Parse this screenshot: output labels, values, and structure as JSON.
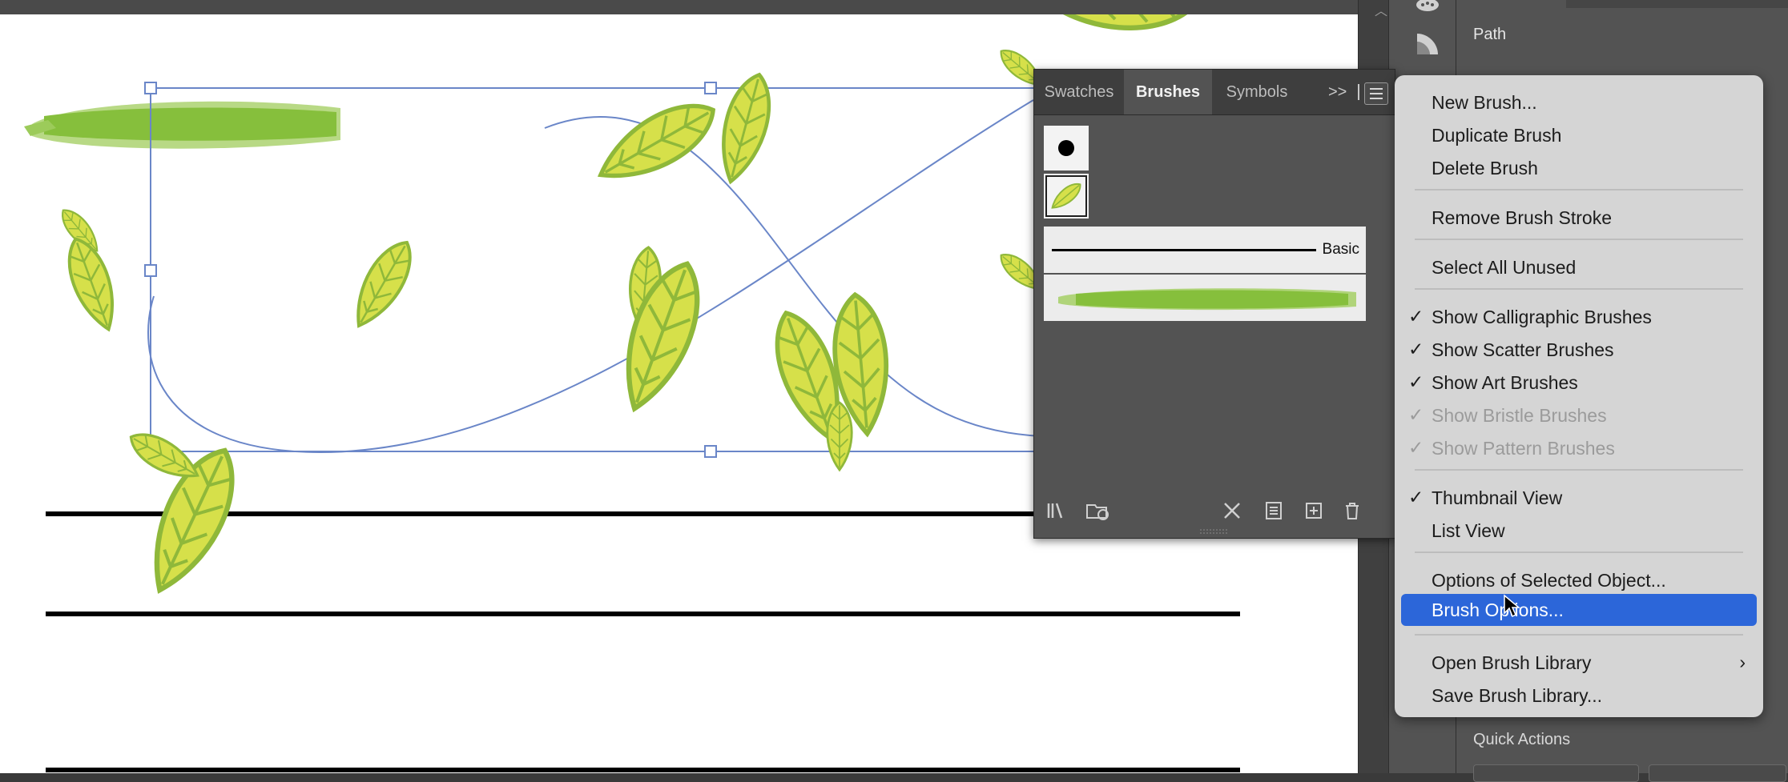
{
  "properties": {
    "path_label": "Path",
    "quick_actions_label": "Quick Actions"
  },
  "brushes_panel": {
    "tabs": [
      "Swatches",
      "Brushes",
      "Symbols"
    ],
    "more_label": ">>",
    "active_tab": "Brushes",
    "basic_label": "Basic"
  },
  "flyout": {
    "items": [
      {
        "label": "New Brush...",
        "checked": false,
        "disabled": false
      },
      {
        "label": "Duplicate Brush",
        "checked": false,
        "disabled": false
      },
      {
        "label": "Delete Brush",
        "checked": false,
        "disabled": false
      },
      {
        "label": "Remove Brush Stroke",
        "checked": false,
        "disabled": false
      },
      {
        "label": "Select All Unused",
        "checked": false,
        "disabled": false
      },
      {
        "label": "Show Calligraphic Brushes",
        "checked": true,
        "disabled": false
      },
      {
        "label": "Show Scatter Brushes",
        "checked": true,
        "disabled": false
      },
      {
        "label": "Show Art Brushes",
        "checked": true,
        "disabled": false
      },
      {
        "label": "Show Bristle Brushes",
        "checked": true,
        "disabled": true
      },
      {
        "label": "Show Pattern Brushes",
        "checked": true,
        "disabled": true
      },
      {
        "label": "Thumbnail View",
        "checked": true,
        "disabled": false
      },
      {
        "label": "List View",
        "checked": false,
        "disabled": false
      },
      {
        "label": "Options of Selected Object...",
        "checked": false,
        "disabled": false
      },
      {
        "label": "Brush Options...",
        "checked": false,
        "disabled": false,
        "highlighted": true
      },
      {
        "label": "Open Brush Library",
        "checked": false,
        "disabled": false,
        "submenu": true
      },
      {
        "label": "Save Brush Library...",
        "checked": false,
        "disabled": false
      }
    ],
    "check_glyph": "✓",
    "submenu_glyph": "›"
  },
  "colors": {
    "leaf_fill": "#d6e04a",
    "leaf_stroke": "#8fb83a",
    "brush_green": "#8cc43e",
    "selection_blue": "#6a86c8",
    "menu_highlight": "#2c66d9"
  }
}
